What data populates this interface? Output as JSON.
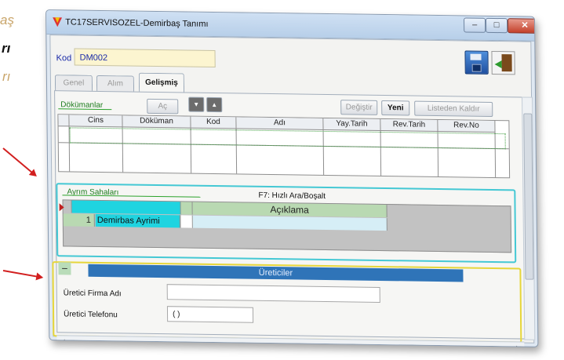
{
  "background": {
    "lines": [
      "aş",
      "rı",
      "rı"
    ]
  },
  "window": {
    "title": "TC17SERVISOZEL-Demirbaş Tanımı",
    "controls": {
      "minimize": "–",
      "maximize": "□",
      "close": "✕"
    }
  },
  "header": {
    "kod_label": "Kod",
    "kod_value": "DM002"
  },
  "tabs": [
    {
      "label": "Genel"
    },
    {
      "label": "Alım"
    },
    {
      "label": "Gelişmiş"
    }
  ],
  "dokumanlar": {
    "label": "Dökümanlar",
    "ac_button": "Aç",
    "down_button": "▼",
    "up_button": "▲",
    "degistir_button": "Değiştir",
    "yeni_button": "Yeni",
    "listeden_kaldir_button": "Listeden Kaldır",
    "columns": [
      "Cins",
      "Döküman",
      "Kod",
      "Adı",
      "Yay.Tarih",
      "Rev.Tarih",
      "Rev.No"
    ]
  },
  "ayrim": {
    "label": "Ayrım Sahaları",
    "hint": "F7: Hızlı Ara/Boşalt",
    "column": "Açıklama",
    "rows": [
      {
        "no": "1",
        "name": "Demirbas Ayrimi",
        "desc": ""
      }
    ]
  },
  "ureticiler": {
    "collapse": "–",
    "title": "Üreticiler",
    "firma_label": "Üretici Firma Adı",
    "firma_value": "",
    "telefon_label": "Üretici Telefonu",
    "telefon_value": "(   )"
  },
  "colors": {
    "accent_blue": "#2f74b8",
    "cyan_highlight": "#44c8d4",
    "yellow_highlight": "#e6d63a",
    "arrow_red": "#d21f1f"
  }
}
